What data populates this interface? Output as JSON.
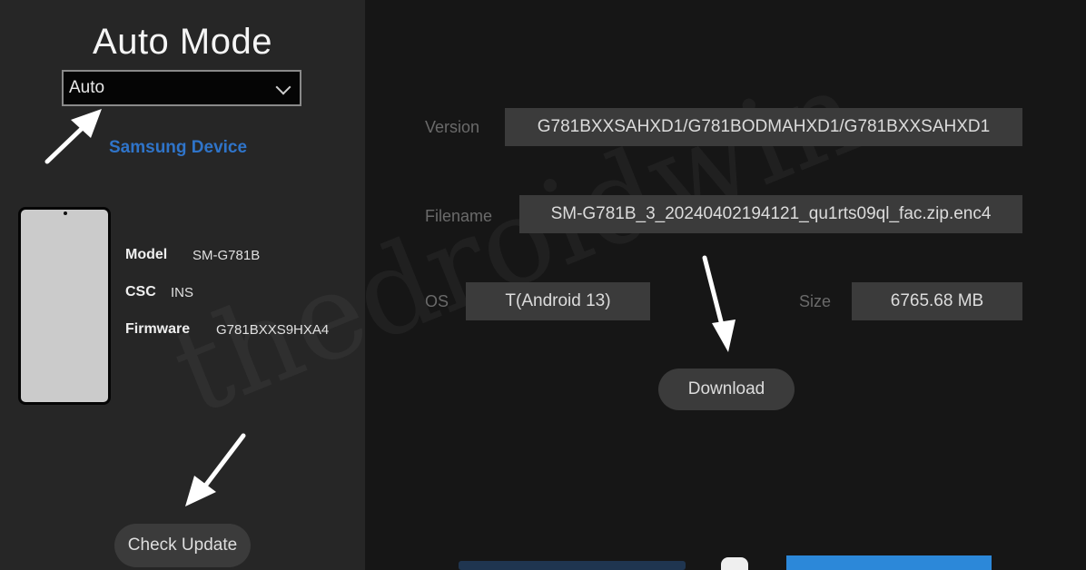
{
  "left": {
    "title": "Auto Mode",
    "mode": {
      "selected": "Auto"
    },
    "device_link": "Samsung Device",
    "specs": [
      {
        "label": "Model",
        "value": "SM-G781B"
      },
      {
        "label": "CSC",
        "value": "INS"
      },
      {
        "label": "Firmware",
        "value": "G781BXXS9HXA4"
      }
    ],
    "check_update": "Check Update"
  },
  "right": {
    "version": {
      "label": "Version",
      "value": "G781BXXSAHXD1/G781BODMAHXD1/G781BXXSAHXD1"
    },
    "filename": {
      "label": "Filename",
      "value": "SM-G781B_3_20240402194121_qu1rts09ql_fac.zip.enc4"
    },
    "os": {
      "label": "OS",
      "value": "T(Android 13)"
    },
    "size": {
      "label": "Size",
      "value": "6765.68 MB"
    },
    "download": "Download"
  },
  "icons": [
    "chevron-down-icon",
    "arrow-pointer-icon"
  ],
  "colors": {
    "accent_blue": "#2c88d9",
    "link_blue": "#2f74c9"
  }
}
